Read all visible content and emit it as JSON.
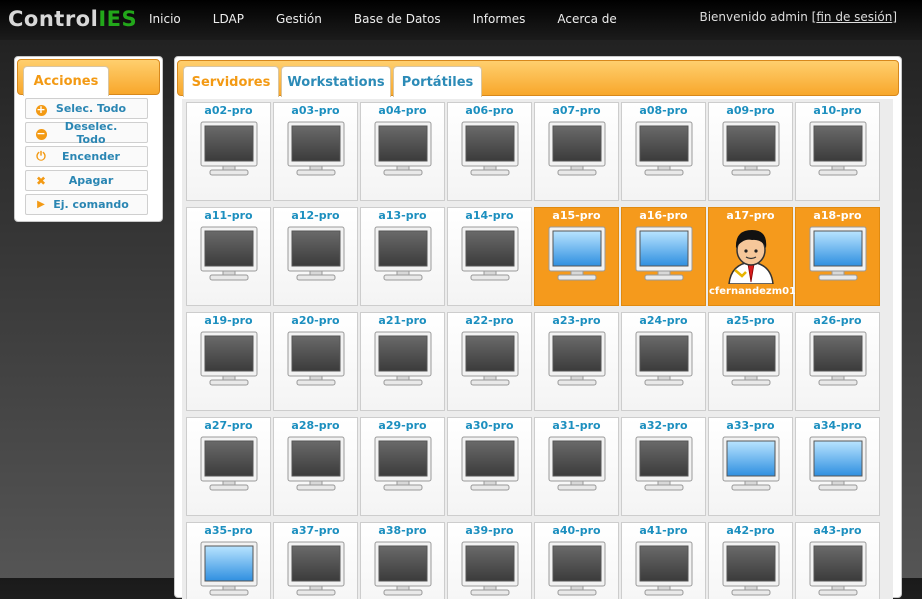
{
  "app": {
    "title_part1": "Control",
    "title_part2": "IES"
  },
  "nav": [
    "Inicio",
    "LDAP",
    "Gestión",
    "Base de Datos",
    "Informes",
    "Acerca de"
  ],
  "user": {
    "welcome": "Bienvenido admin [",
    "logout": "fin de sesión",
    "close": "]"
  },
  "left_panel": {
    "tab": "Acciones",
    "actions": [
      {
        "label": "Selec. Todo",
        "icon": "plus-circle-icon"
      },
      {
        "label": "Deselec. Todo",
        "icon": "minus-circle-icon"
      },
      {
        "label": "Encender",
        "icon": "power-icon"
      },
      {
        "label": "Apagar",
        "icon": "x-icon"
      },
      {
        "label": "Ej. comando",
        "icon": "play-icon"
      }
    ]
  },
  "tabs": [
    {
      "label": "Servidores",
      "active": true
    },
    {
      "label": "Workstations",
      "active": false
    },
    {
      "label": "Portátiles",
      "active": false
    }
  ],
  "computers": [
    {
      "name": "a02-pro",
      "state": "off"
    },
    {
      "name": "a03-pro",
      "state": "off"
    },
    {
      "name": "a04-pro",
      "state": "off"
    },
    {
      "name": "a06-pro",
      "state": "off"
    },
    {
      "name": "a07-pro",
      "state": "off"
    },
    {
      "name": "a08-pro",
      "state": "off"
    },
    {
      "name": "a09-pro",
      "state": "off"
    },
    {
      "name": "a10-pro",
      "state": "off"
    },
    {
      "name": "a11-pro",
      "state": "off"
    },
    {
      "name": "a12-pro",
      "state": "off"
    },
    {
      "name": "a13-pro",
      "state": "off"
    },
    {
      "name": "a14-pro",
      "state": "off"
    },
    {
      "name": "a15-pro",
      "state": "on",
      "selected": true
    },
    {
      "name": "a16-pro",
      "state": "on",
      "selected": true
    },
    {
      "name": "a17-pro",
      "state": "user",
      "selected": true,
      "user": "cfernandezm01"
    },
    {
      "name": "a18-pro",
      "state": "on",
      "selected": true
    },
    {
      "name": "a19-pro",
      "state": "off"
    },
    {
      "name": "a20-pro",
      "state": "off"
    },
    {
      "name": "a21-pro",
      "state": "off"
    },
    {
      "name": "a22-pro",
      "state": "off"
    },
    {
      "name": "a23-pro",
      "state": "off"
    },
    {
      "name": "a24-pro",
      "state": "off"
    },
    {
      "name": "a25-pro",
      "state": "off"
    },
    {
      "name": "a26-pro",
      "state": "off"
    },
    {
      "name": "a27-pro",
      "state": "off"
    },
    {
      "name": "a28-pro",
      "state": "off"
    },
    {
      "name": "a29-pro",
      "state": "off"
    },
    {
      "name": "a30-pro",
      "state": "off"
    },
    {
      "name": "a31-pro",
      "state": "off"
    },
    {
      "name": "a32-pro",
      "state": "off"
    },
    {
      "name": "a33-pro",
      "state": "on"
    },
    {
      "name": "a34-pro",
      "state": "on"
    },
    {
      "name": "a35-pro",
      "state": "on"
    },
    {
      "name": "a37-pro",
      "state": "off"
    },
    {
      "name": "a38-pro",
      "state": "off"
    },
    {
      "name": "a39-pro",
      "state": "off"
    },
    {
      "name": "a40-pro",
      "state": "off"
    },
    {
      "name": "a41-pro",
      "state": "off"
    },
    {
      "name": "a42-pro",
      "state": "off"
    },
    {
      "name": "a43-pro",
      "state": "off"
    }
  ],
  "colors": {
    "accent": "#f39a14",
    "link": "#1c8fbf",
    "logo_green": "#22a71a"
  }
}
